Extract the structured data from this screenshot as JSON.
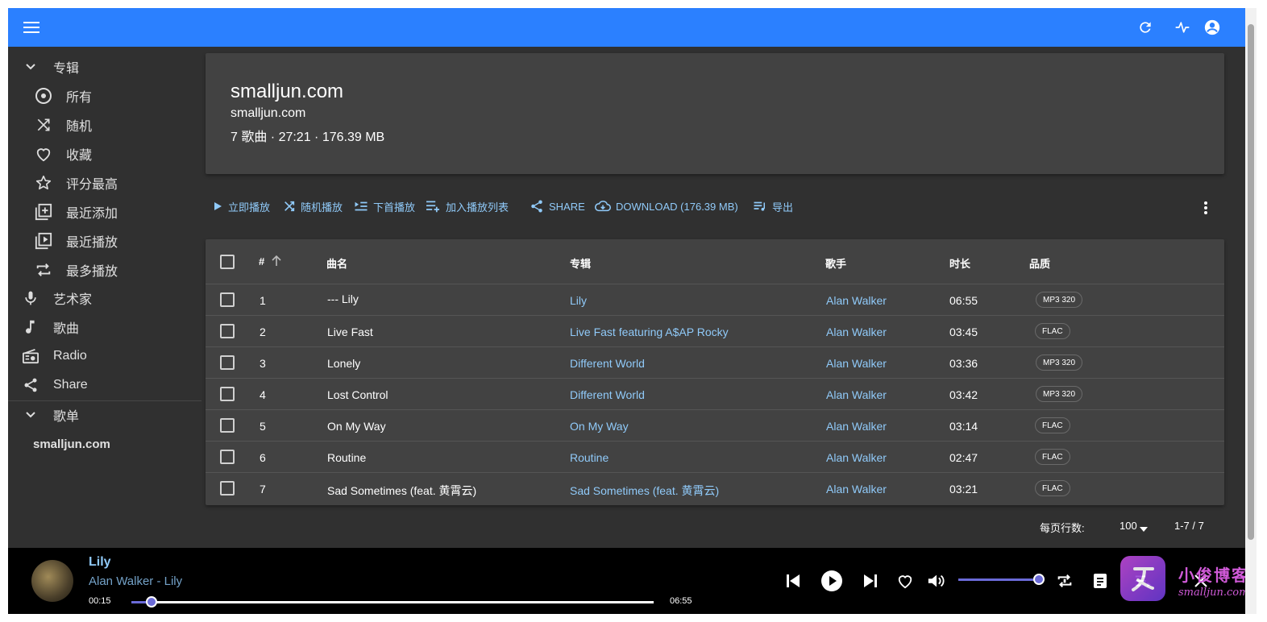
{
  "sidebar": {
    "albums_header": "专辑",
    "items": [
      {
        "label": "所有",
        "icon": "album-icon"
      },
      {
        "label": "随机",
        "icon": "shuffle-icon"
      },
      {
        "label": "收藏",
        "icon": "heart-icon"
      },
      {
        "label": "评分最高",
        "icon": "star-icon"
      },
      {
        "label": "最近添加",
        "icon": "library-add-icon"
      },
      {
        "label": "最近播放",
        "icon": "play-library-icon"
      },
      {
        "label": "最多播放",
        "icon": "repeat-icon"
      }
    ],
    "artists": "艺术家",
    "songs": "歌曲",
    "radio": "Radio",
    "share": "Share",
    "playlists_header": "歌单",
    "playlist": "smalljun.com"
  },
  "header": {
    "title": "smalljun.com",
    "subtitle": "smalljun.com",
    "meta": "7 歌曲 · 27:21 · 176.39 MB"
  },
  "actions": {
    "play": "立即播放",
    "shuffle": "随机播放",
    "play_next": "下首播放",
    "add_to_queue": "加入播放列表",
    "share": "SHARE",
    "download": "DOWNLOAD (176.39 MB)",
    "export": "导出"
  },
  "table": {
    "columns": {
      "index": "#",
      "title": "曲名",
      "album": "专辑",
      "artist": "歌手",
      "duration": "时长",
      "quality": "品质"
    },
    "rows": [
      {
        "index": "1",
        "title": "---   Lily",
        "album": "Lily",
        "artist": "Alan Walker",
        "duration": "06:55",
        "quality": "MP3 320"
      },
      {
        "index": "2",
        "title": "Live Fast",
        "album": "Live Fast featuring A$AP Rocky",
        "artist": "Alan Walker",
        "duration": "03:45",
        "quality": "FLAC"
      },
      {
        "index": "3",
        "title": "Lonely",
        "album": "Different World",
        "artist": "Alan Walker",
        "duration": "03:36",
        "quality": "MP3 320"
      },
      {
        "index": "4",
        "title": "Lost Control",
        "album": "Different World",
        "artist": "Alan Walker",
        "duration": "03:42",
        "quality": "MP3 320"
      },
      {
        "index": "5",
        "title": "On My Way",
        "album": "On My Way",
        "artist": "Alan Walker",
        "duration": "03:14",
        "quality": "FLAC"
      },
      {
        "index": "6",
        "title": "Routine",
        "album": "Routine",
        "artist": "Alan Walker",
        "duration": "02:47",
        "quality": "FLAC"
      },
      {
        "index": "7",
        "title": "Sad Sometimes (feat. 黄霄云)",
        "album": "Sad Sometimes (feat. 黄霄云)",
        "artist": "Alan Walker",
        "duration": "03:21",
        "quality": "FLAC"
      }
    ]
  },
  "pager": {
    "rows_per_page_label": "每页行数:",
    "rows_per_page": "100",
    "range": "1-7 / 7"
  },
  "player": {
    "title": "Lily",
    "artist_line": "Alan Walker - Lily",
    "elapsed": "00:15",
    "total": "06:55",
    "progress": 0.036,
    "volume": 1.0
  },
  "watermark": {
    "cn": "小俊博客",
    "en": "smalljun.com"
  },
  "colors": {
    "appbar": "#2b80ff",
    "link": "#90caf9",
    "accent": "#6b6bd8"
  }
}
